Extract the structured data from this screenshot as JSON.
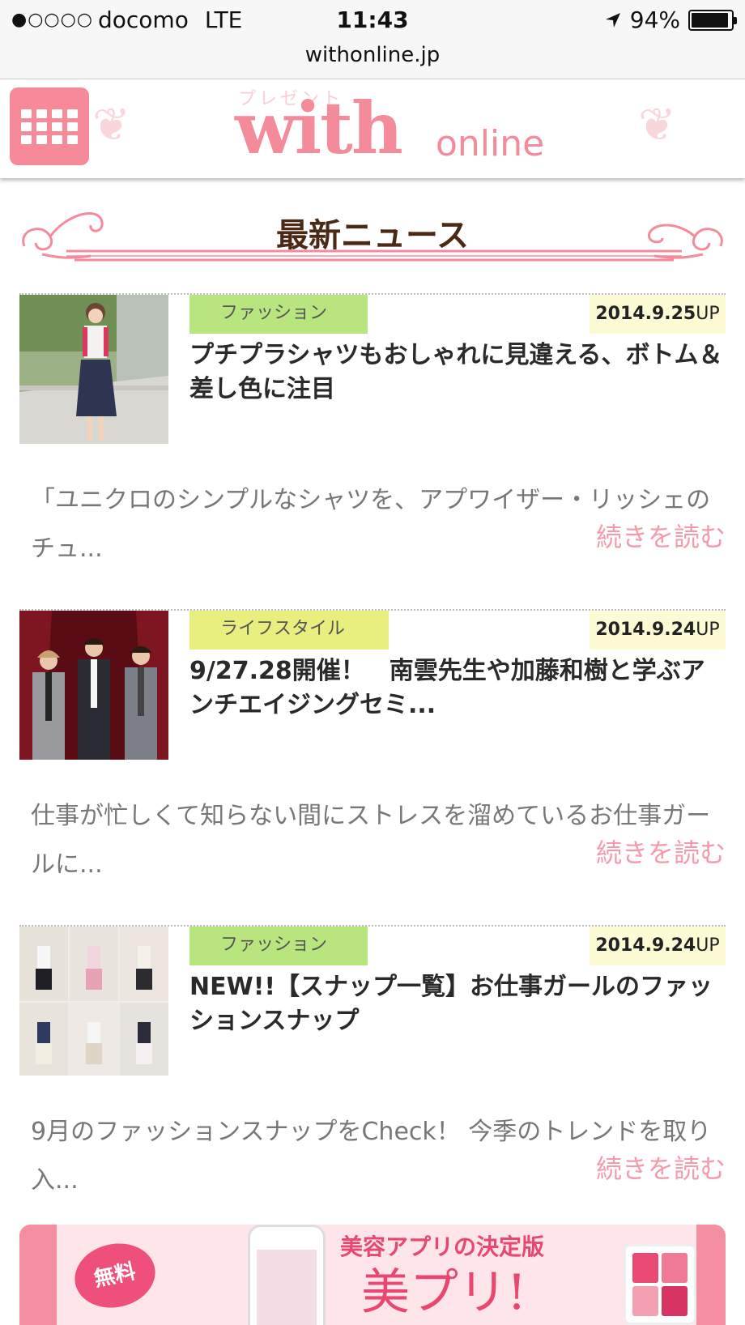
{
  "statusbar": {
    "signal": "●○○○○",
    "carrier": "docomo",
    "network": "LTE",
    "time": "11:43",
    "battery": "94%",
    "battery_level": 0.94
  },
  "browser": {
    "url": "withonline.jp"
  },
  "header": {
    "logo_main": "with",
    "logo_sub": "online",
    "logo_bg_text": "プレゼント"
  },
  "section": {
    "title": "最新ニュース"
  },
  "news": [
    {
      "category": "ファッション",
      "date": "2014.9.25",
      "date_suffix": "UP",
      "title": "プチプラシャツもおしゃれに見違える、ボトム＆差し色に注目",
      "excerpt": "「ユニクロのシンプルなシャツを、アプワイザー・リッシェのチュ...",
      "readmore": "続きを読む"
    },
    {
      "category": "ライフスタイル",
      "date": "2014.9.24",
      "date_suffix": "UP",
      "title": "9/27.28開催！　南雲先生や加藤和樹と学ぶアンチエイジングセミ...",
      "excerpt": "仕事が忙しくて知らない間にストレスを溜めているお仕事ガールに...",
      "readmore": "続きを読む"
    },
    {
      "category": "ファッション",
      "date": "2014.9.24",
      "date_suffix": "UP",
      "title": "NEW!!【スナップ一覧】お仕事ガールのファッションスナップ",
      "excerpt": "9月のファッションスナップをCheck！ 今季のトレンドを取り入...",
      "readmore": "続きを読む"
    }
  ],
  "banner": {
    "badge": "無料",
    "copy": "美容アプリの決定版",
    "title": "美プリ!"
  },
  "colors": {
    "brand_pink": "#f48b9b",
    "tag_fashion": "#b9e57f",
    "tag_lifestyle": "#e8ef7e",
    "date_bg": "#fdfbd6",
    "readmore": "#f59aaa"
  }
}
